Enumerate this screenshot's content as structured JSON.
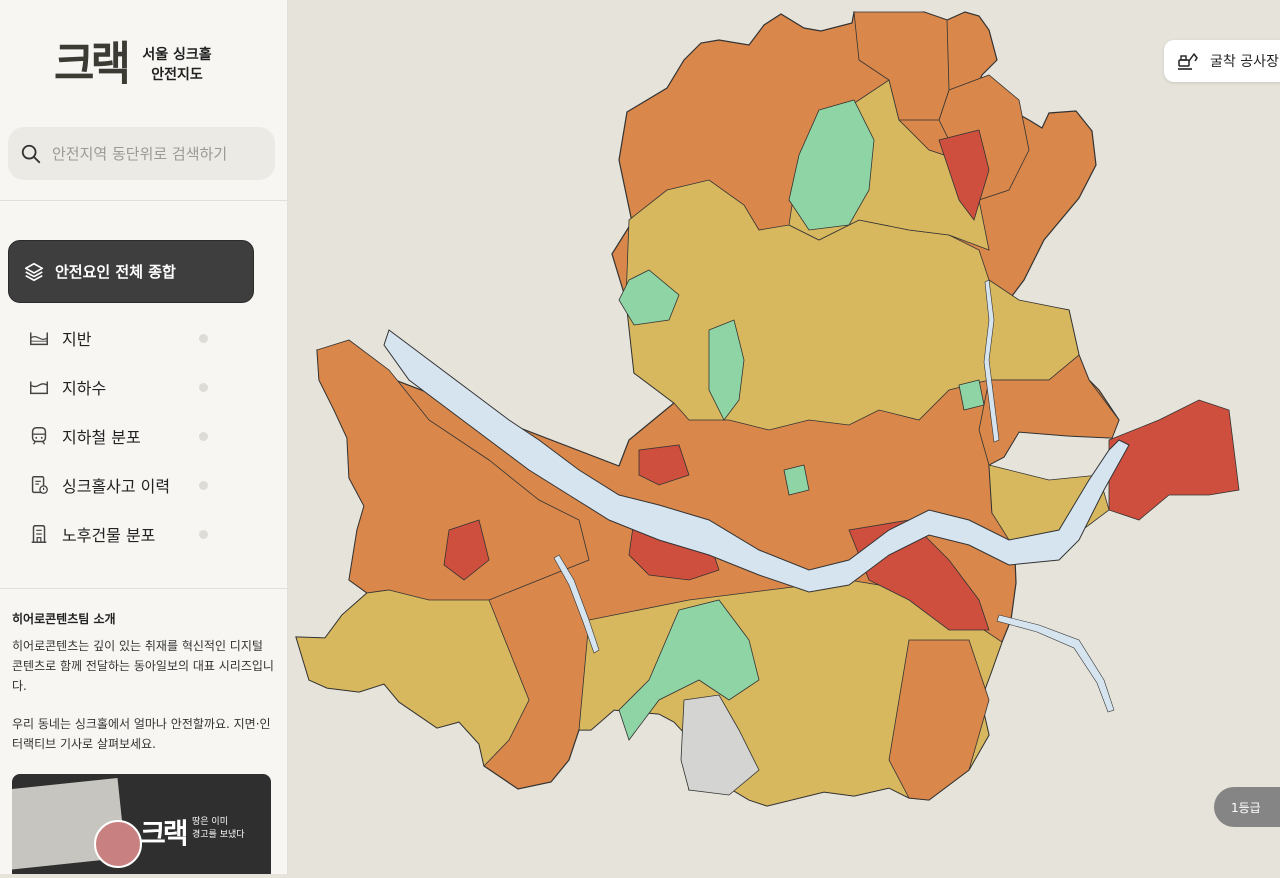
{
  "brand": {
    "logo_text": "크랙",
    "title_line1": "서울 싱크홀",
    "title_line2": "안전지도"
  },
  "search": {
    "placeholder": "안전지역 동단위로 검색하기",
    "icon": "search-icon"
  },
  "primary_button": {
    "label": "안전요인 전체 종합",
    "icon": "layers-icon"
  },
  "menu": [
    {
      "label": "지반",
      "icon": "ground-icon"
    },
    {
      "label": "지하수",
      "icon": "groundwater-icon"
    },
    {
      "label": "지하철 분포",
      "icon": "subway-icon"
    },
    {
      "label": "싱크홀사고 이력",
      "icon": "incident-history-icon"
    },
    {
      "label": "노후건물 분포",
      "icon": "building-icon"
    }
  ],
  "intro": {
    "title": "히어로콘텐츠팀 소개",
    "paragraph1": "히어로콘텐츠는 깊이 있는 취재를 혁신적인 디지털 콘텐츠로 함께 전달하는 동아일보의 대표 시리즈입니다.",
    "paragraph2": "우리 동네는 싱크홀에서 얼마나 안전할까요. 지면·인터랙티브 기사로 살펴보세요."
  },
  "promo": {
    "logo_text": "크랙",
    "line1": "땅은 이미",
    "line2": "경고를 보냈다"
  },
  "map": {
    "construction_button": {
      "label": "굴착 공사장",
      "icon": "excavator-icon"
    },
    "grade_label": "1등급",
    "colors": {
      "background": "#e5e3da",
      "river": "#d6e4f0",
      "safest": "#8fd4a4",
      "safe": "#d8b85f",
      "caution": "#d9874a",
      "danger": "#cf4f3f",
      "no_data": "#d4d4d2"
    }
  }
}
